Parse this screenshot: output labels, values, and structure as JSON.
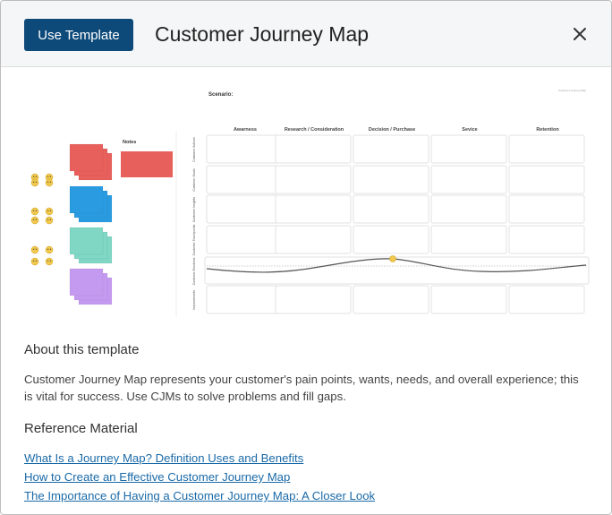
{
  "header": {
    "use_template_label": "Use Template",
    "title": "Customer Journey Map",
    "close_icon": "close-icon"
  },
  "preview": {
    "scenario_label": "Scenario:",
    "corner_label": "Customer Journey Map",
    "notes_label": "Notes",
    "stages": [
      "Awarness",
      "Research / Consideration",
      "Decision / Purchase",
      "Sevice",
      "Retention"
    ],
    "row_labels": [
      "Customer Actions",
      "Customer Goals",
      "Customer Insights",
      "Customer Touchpoints",
      "Customer Emotions",
      "Improvements"
    ],
    "sticky_colors": [
      "#e8605c",
      "#2a9be0",
      "#7fd7c4",
      "#c49af0"
    ],
    "note_color": "#e8605c",
    "emoji_color": "#f2c94c"
  },
  "about": {
    "heading": "About this template",
    "text": "Customer Journey Map represents your customer's pain points, wants, needs, and overall experience; this is vital for success. Use CJMs to solve problems and fill gaps."
  },
  "reference": {
    "heading": "Reference Material",
    "links": [
      "What Is a Journey Map? Definition Uses and Benefits",
      "How to Create an Effective Customer Journey Map",
      "The Importance of Having a Customer Journey Map: A Closer Look"
    ]
  }
}
